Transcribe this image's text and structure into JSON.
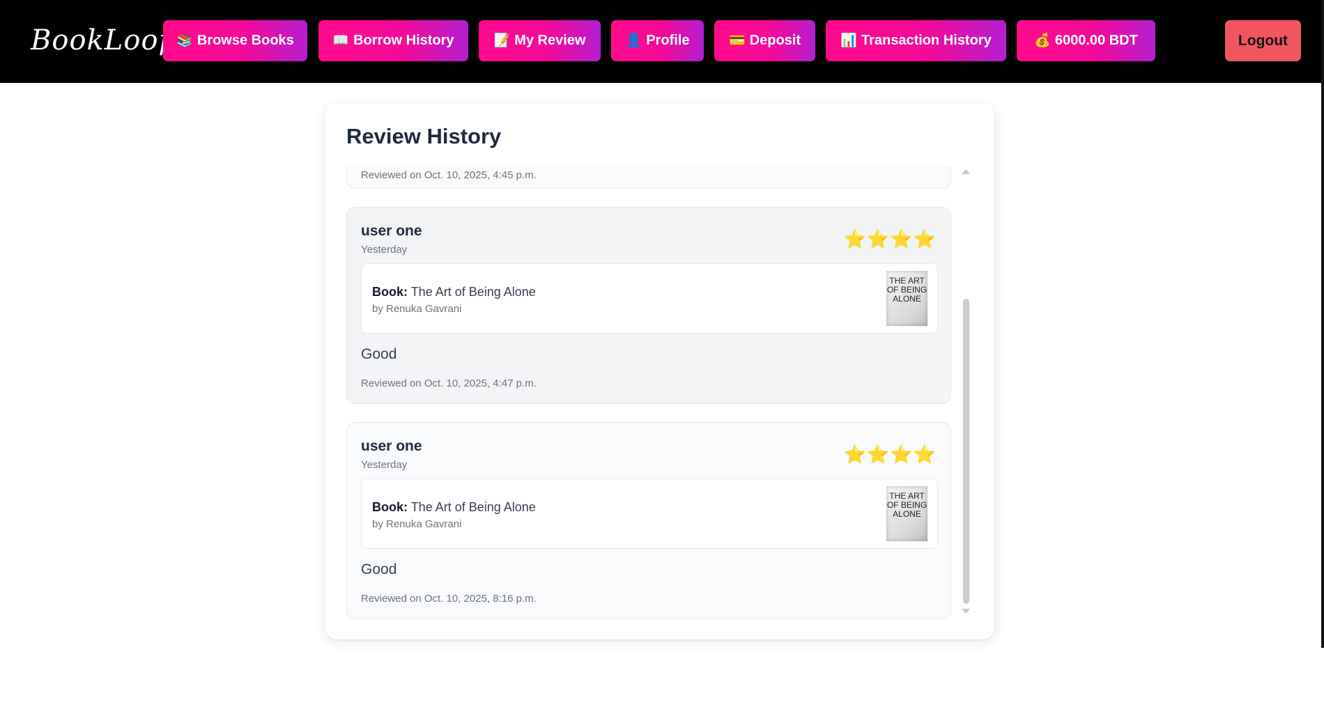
{
  "nav": {
    "logo": "BookLoop",
    "items": [
      {
        "icon": "📚",
        "label": "Browse Books"
      },
      {
        "icon": "📖",
        "label": "Borrow History"
      },
      {
        "icon": "📝",
        "label": "My Review"
      },
      {
        "icon": "👤",
        "label": "Profile"
      },
      {
        "icon": "💳",
        "label": "Deposit"
      },
      {
        "icon": "📊",
        "label": "Transaction History"
      },
      {
        "icon": "💰",
        "label": "6000.00 BDT"
      }
    ],
    "logout": "Logout"
  },
  "page": {
    "title": "Review History",
    "partial_stamp": "Reviewed on Oct. 10, 2025, 4:45 p.m."
  },
  "reviews": [
    {
      "user": "user one",
      "when": "Yesterday",
      "stars": "⭐⭐⭐⭐",
      "rating": 4,
      "book_label": "Book:",
      "book_title": "The Art of Being Alone",
      "author": "by Renuka Gavrani",
      "cover_text": "THE ART OF BEING ALONE",
      "body": "Good",
      "stamp": "Reviewed on Oct. 10, 2025, 4:47 p.m."
    },
    {
      "user": "user one",
      "when": "Yesterday",
      "stars": "⭐⭐⭐⭐",
      "rating": 4,
      "book_label": "Book:",
      "book_title": "The Art of Being Alone",
      "author": "by Renuka Gavrani",
      "cover_text": "THE ART OF BEING ALONE",
      "body": "Good",
      "stamp": "Reviewed on Oct. 10, 2025, 8:16 p.m."
    }
  ],
  "colors": {
    "nav_gradient_start": "#ff0a8c",
    "nav_gradient_end": "#b51fd0",
    "logout_bg": "#f1565f",
    "star": "#f5b50a"
  }
}
